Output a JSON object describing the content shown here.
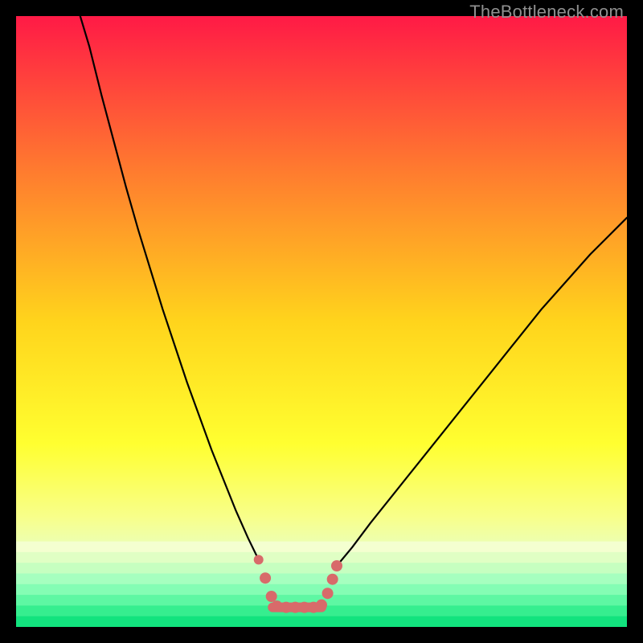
{
  "watermark": "TheBottleneck.com",
  "chart_data": {
    "type": "line",
    "title": "",
    "xlabel": "",
    "ylabel": "",
    "xlim": [
      0,
      100
    ],
    "ylim": [
      0,
      100
    ],
    "grid": false,
    "legend": false,
    "background_gradient": {
      "stops": [
        {
          "pos": 0.0,
          "color": "#ff1a46"
        },
        {
          "pos": 0.25,
          "color": "#ff7a2f"
        },
        {
          "pos": 0.5,
          "color": "#ffd41c"
        },
        {
          "pos": 0.7,
          "color": "#ffff30"
        },
        {
          "pos": 0.82,
          "color": "#f8ff8a"
        },
        {
          "pos": 0.88,
          "color": "#e8ffc0"
        },
        {
          "pos": 0.93,
          "color": "#b6ffcf"
        },
        {
          "pos": 0.965,
          "color": "#5efc9c"
        },
        {
          "pos": 1.0,
          "color": "#00e37a"
        }
      ]
    },
    "series": [
      {
        "name": "left-curve",
        "stroke": "#000000",
        "points": [
          {
            "x": 10.5,
            "y": 100.0
          },
          {
            "x": 12.0,
            "y": 95.0
          },
          {
            "x": 14.0,
            "y": 87.0
          },
          {
            "x": 16.0,
            "y": 79.5
          },
          {
            "x": 18.0,
            "y": 72.0
          },
          {
            "x": 20.0,
            "y": 65.0
          },
          {
            "x": 22.0,
            "y": 58.5
          },
          {
            "x": 24.0,
            "y": 52.0
          },
          {
            "x": 26.0,
            "y": 46.0
          },
          {
            "x": 28.0,
            "y": 40.0
          },
          {
            "x": 30.0,
            "y": 34.5
          },
          {
            "x": 32.0,
            "y": 29.0
          },
          {
            "x": 34.0,
            "y": 24.0
          },
          {
            "x": 36.0,
            "y": 19.0
          },
          {
            "x": 38.0,
            "y": 14.5
          },
          {
            "x": 39.7,
            "y": 11.0
          }
        ]
      },
      {
        "name": "right-curve",
        "stroke": "#000000",
        "points": [
          {
            "x": 52.5,
            "y": 10.0
          },
          {
            "x": 55.0,
            "y": 13.0
          },
          {
            "x": 58.0,
            "y": 17.0
          },
          {
            "x": 62.0,
            "y": 22.0
          },
          {
            "x": 66.0,
            "y": 27.0
          },
          {
            "x": 70.0,
            "y": 32.0
          },
          {
            "x": 74.0,
            "y": 37.0
          },
          {
            "x": 78.0,
            "y": 42.0
          },
          {
            "x": 82.0,
            "y": 47.0
          },
          {
            "x": 86.0,
            "y": 52.0
          },
          {
            "x": 90.0,
            "y": 56.5
          },
          {
            "x": 94.0,
            "y": 61.0
          },
          {
            "x": 97.0,
            "y": 64.0
          },
          {
            "x": 100.0,
            "y": 67.0
          }
        ]
      },
      {
        "name": "bottom-flat",
        "stroke": "#d86a6a",
        "stroke_width": 12,
        "points": [
          {
            "x": 42.0,
            "y": 3.2
          },
          {
            "x": 44.0,
            "y": 3.2
          },
          {
            "x": 46.0,
            "y": 3.2
          },
          {
            "x": 48.0,
            "y": 3.2
          },
          {
            "x": 50.0,
            "y": 3.2
          }
        ]
      }
    ],
    "markers": [
      {
        "x": 39.7,
        "y": 11.0,
        "r": 6,
        "color": "#d86a6a"
      },
      {
        "x": 40.8,
        "y": 8.0,
        "r": 7,
        "color": "#d86a6a"
      },
      {
        "x": 41.8,
        "y": 5.0,
        "r": 7,
        "color": "#d86a6a"
      },
      {
        "x": 42.7,
        "y": 3.4,
        "r": 7,
        "color": "#d86a6a"
      },
      {
        "x": 44.2,
        "y": 3.2,
        "r": 7,
        "color": "#d86a6a"
      },
      {
        "x": 45.7,
        "y": 3.2,
        "r": 7,
        "color": "#d86a6a"
      },
      {
        "x": 47.2,
        "y": 3.2,
        "r": 7,
        "color": "#d86a6a"
      },
      {
        "x": 48.7,
        "y": 3.2,
        "r": 7,
        "color": "#d86a6a"
      },
      {
        "x": 50.0,
        "y": 3.6,
        "r": 7,
        "color": "#d86a6a"
      },
      {
        "x": 51.0,
        "y": 5.5,
        "r": 7,
        "color": "#d86a6a"
      },
      {
        "x": 51.8,
        "y": 7.8,
        "r": 7,
        "color": "#d86a6a"
      },
      {
        "x": 52.5,
        "y": 10.0,
        "r": 7,
        "color": "#d86a6a"
      }
    ]
  }
}
